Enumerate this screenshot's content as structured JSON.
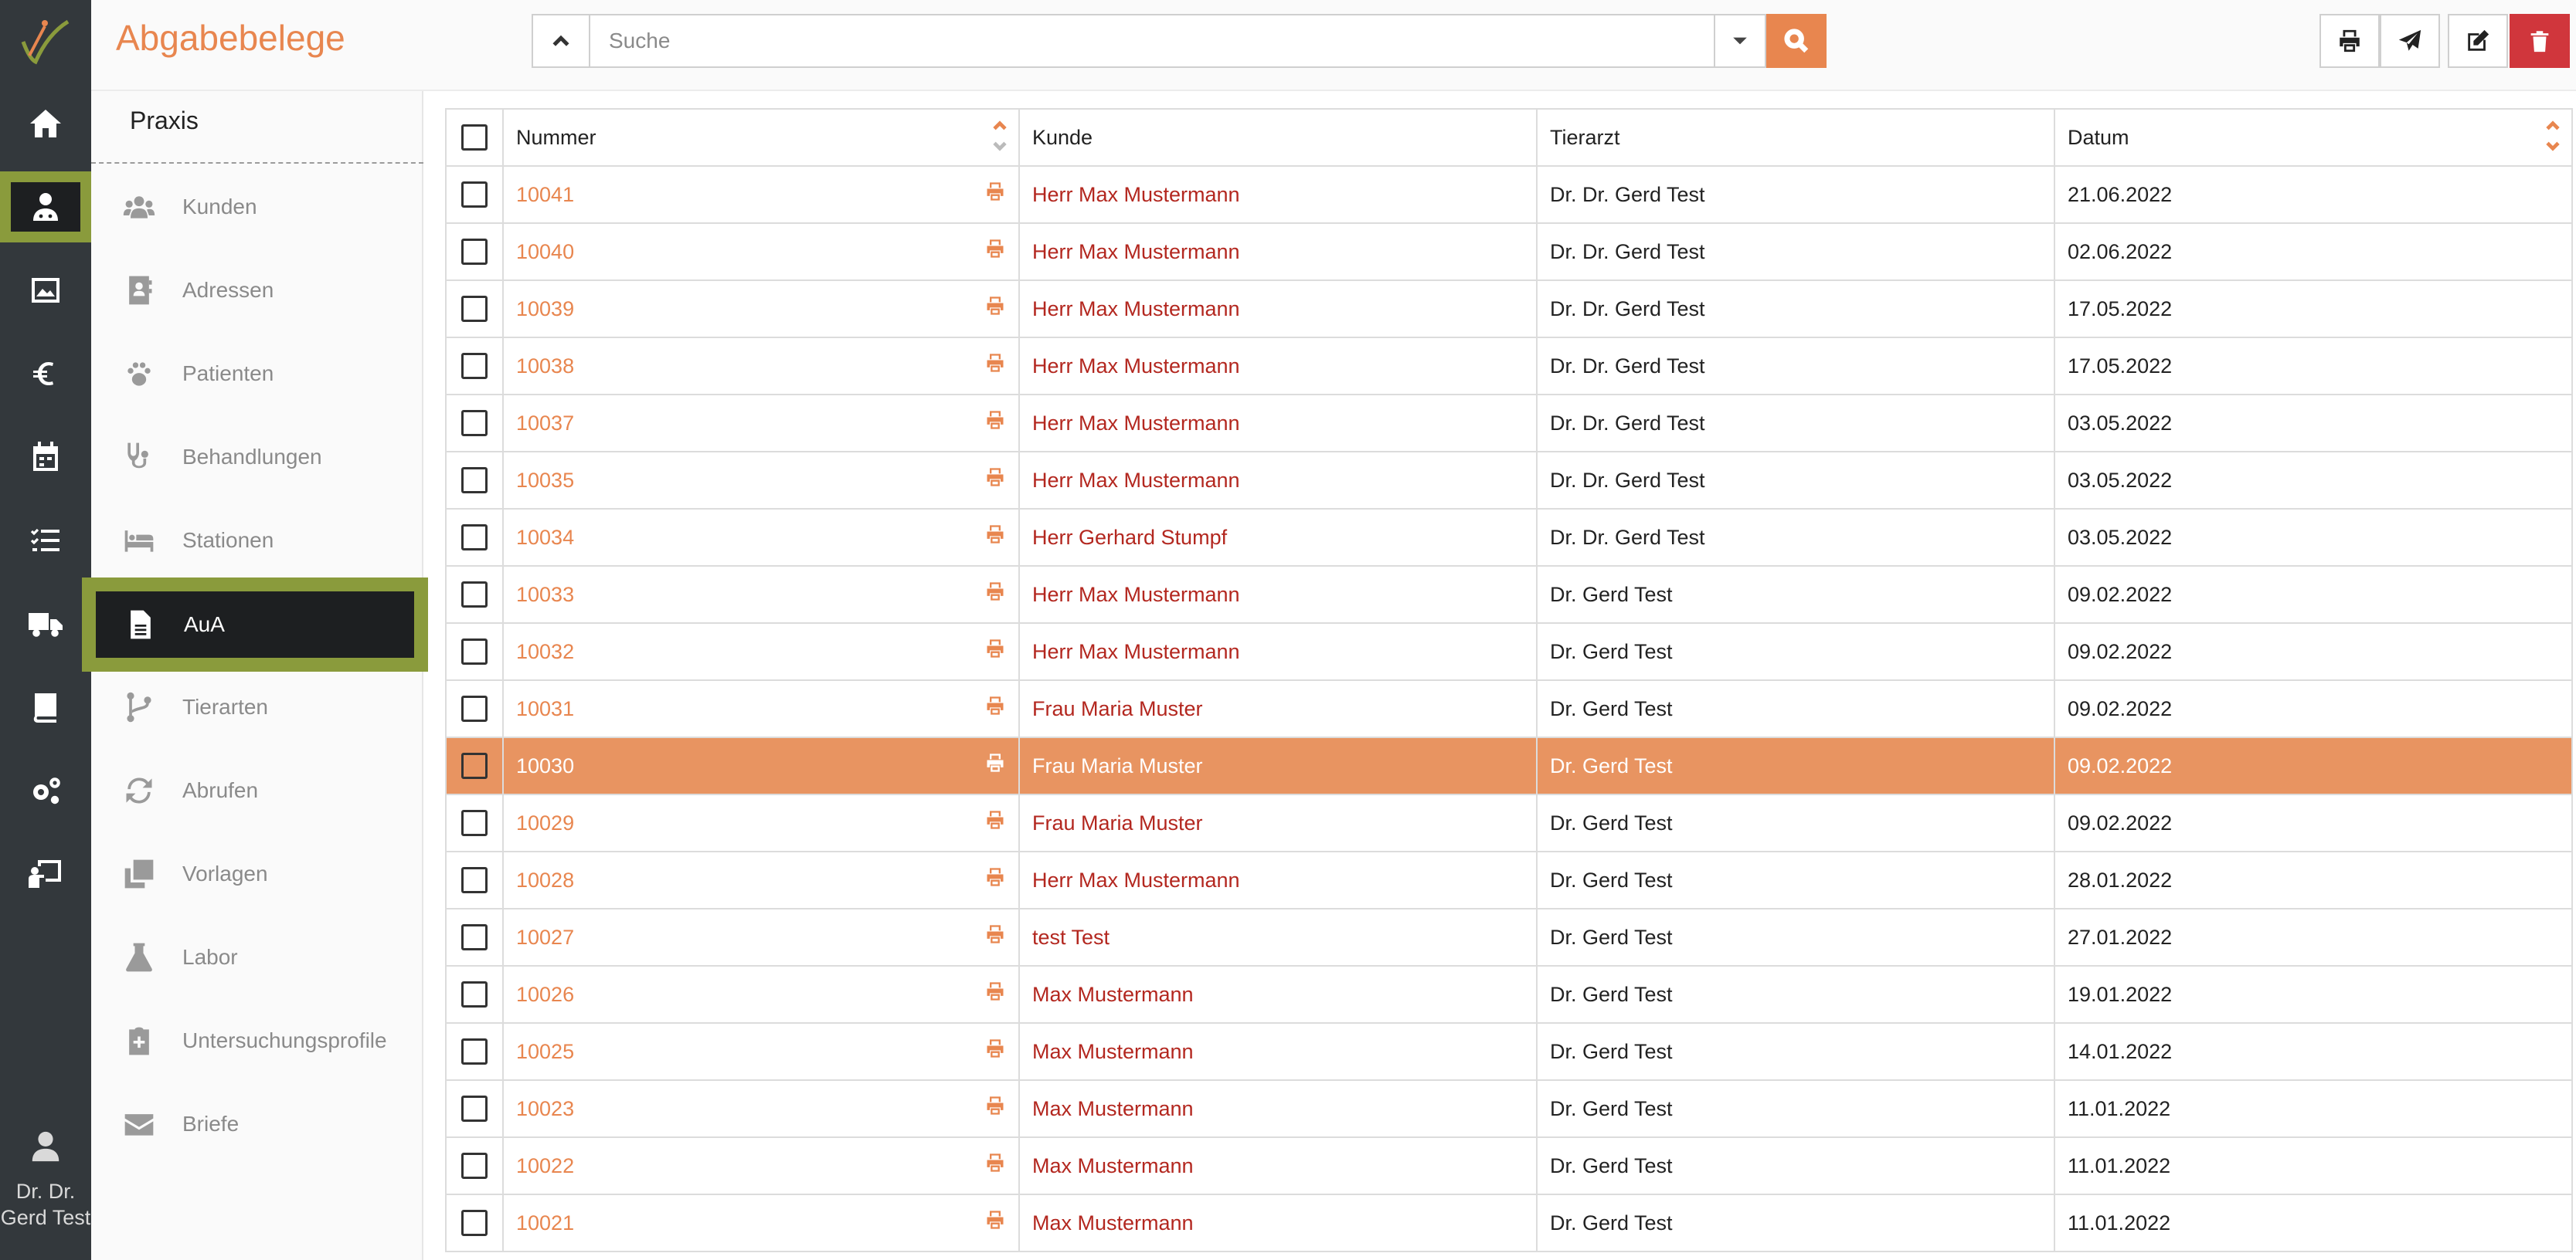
{
  "app": {
    "title": "Abgabebelege"
  },
  "rail": {
    "items": [
      "home-icon",
      "user-md-icon",
      "image-chart-icon",
      "euro-icon",
      "calendar-icon",
      "tasks-icon",
      "truck-icon",
      "book-icon",
      "cogs-icon",
      "teacher-board-icon"
    ],
    "active_index": 1,
    "user_name": "Dr. Dr. Gerd Test"
  },
  "subnav": {
    "heading": "Praxis",
    "items": [
      {
        "label": "Kunden",
        "icon": "users-icon"
      },
      {
        "label": "Adressen",
        "icon": "address-book-icon"
      },
      {
        "label": "Patienten",
        "icon": "paw-icon"
      },
      {
        "label": "Behandlungen",
        "icon": "stethoscope-icon"
      },
      {
        "label": "Stationen",
        "icon": "bed-icon"
      },
      {
        "label": "AuA",
        "icon": "file-icon"
      },
      {
        "label": "Tierarten",
        "icon": "code-branch-icon"
      },
      {
        "label": "Abrufen",
        "icon": "sync-icon"
      },
      {
        "label": "Vorlagen",
        "icon": "clone-icon"
      },
      {
        "label": "Labor",
        "icon": "flask-icon"
      },
      {
        "label": "Untersuchungsprofile",
        "icon": "clipboard-medical-icon"
      },
      {
        "label": "Briefe",
        "icon": "envelope-icon"
      }
    ],
    "active_index": 5
  },
  "search": {
    "placeholder": "Suche",
    "value": ""
  },
  "toolbar": [
    "print-icon",
    "send-icon",
    "edit-icon",
    "trash-icon"
  ],
  "colors": {
    "accent": "#e8864f",
    "highlight": "#8a9b3c",
    "rail": "#33383c",
    "kunde": "#b3271f",
    "danger": "#d0363c"
  },
  "table": {
    "headers": {
      "nummer": "Nummer",
      "kunde": "Kunde",
      "tierarzt": "Tierarzt",
      "datum": "Datum"
    },
    "selected_row": 10,
    "rows": [
      {
        "nummer": "10041",
        "kunde": "Herr Max Mustermann",
        "tierarzt": "Dr. Dr. Gerd Test",
        "datum": "21.06.2022"
      },
      {
        "nummer": "10040",
        "kunde": "Herr Max Mustermann",
        "tierarzt": "Dr. Dr. Gerd Test",
        "datum": "02.06.2022"
      },
      {
        "nummer": "10039",
        "kunde": "Herr Max Mustermann",
        "tierarzt": "Dr. Dr. Gerd Test",
        "datum": "17.05.2022"
      },
      {
        "nummer": "10038",
        "kunde": "Herr Max Mustermann",
        "tierarzt": "Dr. Dr. Gerd Test",
        "datum": "17.05.2022"
      },
      {
        "nummer": "10037",
        "kunde": "Herr Max Mustermann",
        "tierarzt": "Dr. Dr. Gerd Test",
        "datum": "03.05.2022"
      },
      {
        "nummer": "10035",
        "kunde": "Herr Max Mustermann",
        "tierarzt": "Dr. Dr. Gerd Test",
        "datum": "03.05.2022"
      },
      {
        "nummer": "10034",
        "kunde": "Herr Gerhard Stumpf",
        "tierarzt": "Dr. Dr. Gerd Test",
        "datum": "03.05.2022"
      },
      {
        "nummer": "10033",
        "kunde": "Herr Max Mustermann",
        "tierarzt": "Dr. Gerd Test",
        "datum": "09.02.2022"
      },
      {
        "nummer": "10032",
        "kunde": "Herr Max Mustermann",
        "tierarzt": "Dr. Gerd Test",
        "datum": "09.02.2022"
      },
      {
        "nummer": "10031",
        "kunde": "Frau Maria Muster",
        "tierarzt": "Dr. Gerd Test",
        "datum": "09.02.2022"
      },
      {
        "nummer": "10030",
        "kunde": "Frau Maria Muster",
        "tierarzt": "Dr. Gerd Test",
        "datum": "09.02.2022"
      },
      {
        "nummer": "10029",
        "kunde": "Frau Maria Muster",
        "tierarzt": "Dr. Gerd Test",
        "datum": "09.02.2022"
      },
      {
        "nummer": "10028",
        "kunde": "Herr Max Mustermann",
        "tierarzt": "Dr. Gerd Test",
        "datum": "28.01.2022"
      },
      {
        "nummer": "10027",
        "kunde": "test Test",
        "tierarzt": "Dr. Gerd Test",
        "datum": "27.01.2022"
      },
      {
        "nummer": "10026",
        "kunde": "Max Mustermann",
        "tierarzt": "Dr. Gerd Test",
        "datum": "19.01.2022"
      },
      {
        "nummer": "10025",
        "kunde": "Max Mustermann",
        "tierarzt": "Dr. Gerd Test",
        "datum": "14.01.2022"
      },
      {
        "nummer": "10023",
        "kunde": "Max Mustermann",
        "tierarzt": "Dr. Gerd Test",
        "datum": "11.01.2022"
      },
      {
        "nummer": "10022",
        "kunde": "Max Mustermann",
        "tierarzt": "Dr. Gerd Test",
        "datum": "11.01.2022"
      },
      {
        "nummer": "10021",
        "kunde": "Max Mustermann",
        "tierarzt": "Dr. Gerd Test",
        "datum": "11.01.2022"
      }
    ]
  }
}
